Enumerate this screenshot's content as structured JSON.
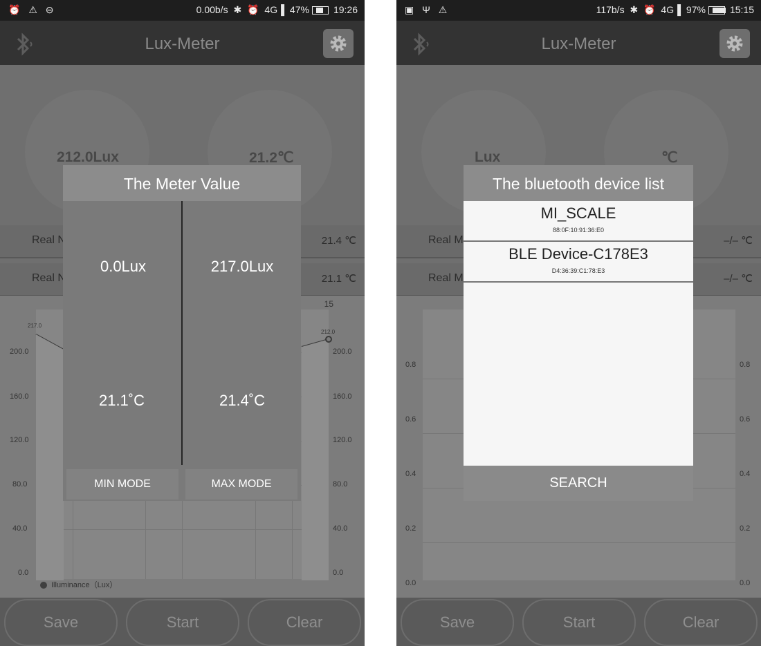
{
  "screen1": {
    "status": {
      "left_icons": "⏰ ⚠ ⊖",
      "net_speed": "0.00b/s",
      "battery_pct": "47%",
      "battery_level": 0.47,
      "time": "19:26"
    },
    "app_title": "Lux-Meter",
    "lux_value": "212.0Lux",
    "temp_value": "21.2℃",
    "real_rows": [
      {
        "label": "Real N",
        "value": "21.4 ℃"
      },
      {
        "label": "Real N",
        "value": "21.1 ℃"
      }
    ],
    "chart": {
      "right_top_label": "15",
      "y_ticks": [
        "200.0",
        "160.0",
        "120.0",
        "80.0",
        "40.0",
        "0.0"
      ],
      "point_left": "217.0",
      "point_right": "212.0",
      "legend": "Illuminance（Lux）"
    },
    "dialog": {
      "title": "The Meter Value",
      "min_lux": "0.0Lux",
      "max_lux": "217.0Lux",
      "min_temp": "21.1˚C",
      "max_temp": "21.4˚C",
      "min_mode_label": "MIN MODE",
      "max_mode_label": "MAX MODE"
    },
    "buttons": {
      "save": "Save",
      "start": "Start",
      "clear": "Clear"
    }
  },
  "screen2": {
    "status": {
      "left_icons": "▣ Ψ ⚠",
      "net_speed": "117b/s",
      "battery_pct": "97%",
      "battery_level": 0.97,
      "time": "15:15"
    },
    "app_title": "Lux-Meter",
    "lux_label": "Lux",
    "temp_label": "℃",
    "real_rows": [
      {
        "label": "Real M",
        "value": "–/– ℃"
      },
      {
        "label": "Real M",
        "value": "–/– ℃"
      }
    ],
    "chart": {
      "y_ticks": [
        "0.8",
        "0.6",
        "0.4",
        "0.2",
        "0.0"
      ]
    },
    "dialog": {
      "title": "The bluetooth device list",
      "devices": [
        {
          "name": "MI_SCALE",
          "mac": "88:0F:10:91:36:E0"
        },
        {
          "name": "BLE Device-C178E3",
          "mac": "D4:36:39:C1:78:E3"
        }
      ],
      "search_label": "SEARCH"
    },
    "buttons": {
      "save": "Save",
      "start": "Start",
      "clear": "Clear"
    }
  }
}
